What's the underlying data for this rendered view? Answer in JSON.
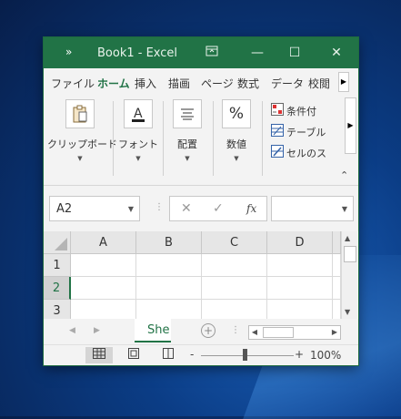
{
  "window": {
    "qat_icon": "more-chevrons-icon",
    "title_text": "Book1  -  Excel",
    "controls": {
      "ribbon_display": "ribbon-display-icon",
      "minimize": "—",
      "maximize": "☐",
      "close": "✕"
    }
  },
  "tabs": [
    {
      "label": "ファイル",
      "active": false
    },
    {
      "label": "ホーム",
      "active": true
    },
    {
      "label": "挿入",
      "active": false
    },
    {
      "label": "描画",
      "active": false
    },
    {
      "label": "ページ",
      "active": false
    },
    {
      "label": "数式",
      "active": false
    },
    {
      "label": "データ",
      "active": false
    },
    {
      "label": "校閲",
      "active": false
    }
  ],
  "ribbon": {
    "groups": [
      {
        "label": "クリップボード",
        "icon": "clipboard-icon"
      },
      {
        "label": "フォント",
        "icon": "font-color-icon"
      },
      {
        "label": "配置",
        "icon": "align-icon"
      },
      {
        "label": "数値",
        "icon": "percent-icon",
        "glyph": "%"
      }
    ],
    "styles": [
      {
        "label": "条件付",
        "icon": "conditional-format-icon"
      },
      {
        "label": "テーブル",
        "icon": "table-format-icon"
      },
      {
        "label": "セルのス",
        "icon": "cell-style-icon"
      }
    ]
  },
  "formula_bar": {
    "name_box": "A2",
    "cancel": "✕",
    "enter": "✓",
    "fx": "fx",
    "formula": ""
  },
  "grid": {
    "columns": [
      "A",
      "B",
      "C",
      "D"
    ],
    "rows": [
      "1",
      "2",
      "3"
    ],
    "selected_row": "2"
  },
  "sheets": {
    "active_tab": "She",
    "add_symbol": "+"
  },
  "status": {
    "zoom_minus": "-",
    "zoom_plus": "+",
    "zoom_level": "100%"
  },
  "colors": {
    "brand": "#217346"
  }
}
